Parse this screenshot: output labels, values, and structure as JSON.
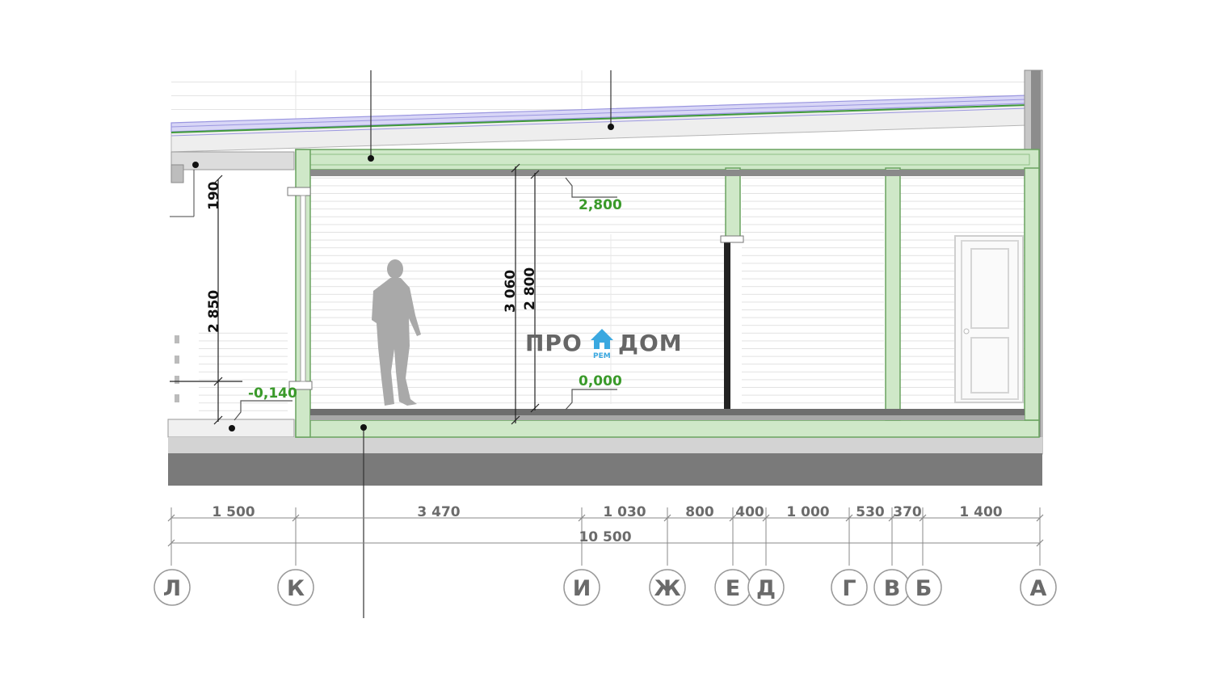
{
  "levels": {
    "ceiling": "2,800",
    "floor": "0,000",
    "terrace": "-0,140"
  },
  "vertical_dims": {
    "upper_left": "190",
    "left_height": "2 850",
    "total_height": "3 060",
    "room_height": "2 800"
  },
  "horizontal_dims": {
    "segments": [
      "1 500",
      "3 470",
      "1 030",
      "800",
      "400",
      "1 000",
      "530",
      "370",
      "1 400"
    ],
    "total": "10 500"
  },
  "axes": [
    "Л",
    "К",
    "И",
    "Ж",
    "Е",
    "Д",
    "Г",
    "В",
    "Б",
    "А"
  ],
  "logo": {
    "left": "ПРО",
    "right": "ДОМ",
    "sub": "РЕМ",
    "accent": "#3aa8e0"
  },
  "colors": {
    "structure_green": "#cfe8c8",
    "structure_stroke": "#6aa360",
    "level_text": "#3a9a2a",
    "ground": "#7a7a7a",
    "roof_membrane": "#9b97e0",
    "figure": "#a9a9a9"
  }
}
